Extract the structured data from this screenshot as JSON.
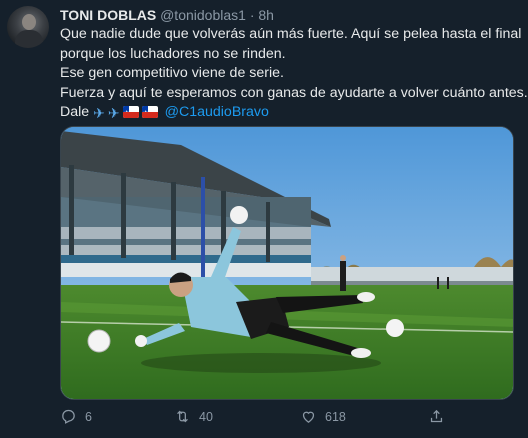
{
  "tweet": {
    "author_name": "TONI DOBLAS",
    "author_handle": "@tonidoblas1",
    "separator": "·",
    "time": "8h",
    "lines": [
      "Que nadie dude que volverás aún más fuerte. Aquí se pelea hasta el final",
      "porque los luchadores no se rinden.",
      "Ese gen competitivo viene de serie.",
      "Fuerza y aquí te esperamos con ganas de ayudarte a volver cuánto antes."
    ],
    "last_line_prefix": "Dale",
    "mention": "@C1audioBravo",
    "emojis": [
      "airplane-icon",
      "airplane-icon",
      "chile-flag-icon",
      "chile-flag-icon"
    ]
  },
  "actions": {
    "replies": "6",
    "retweets": "40",
    "likes": "618"
  },
  "colors": {
    "background": "#15202b",
    "text": "#e7e9ea",
    "secondary": "#8b98a5",
    "accent": "#1d9bf0"
  }
}
